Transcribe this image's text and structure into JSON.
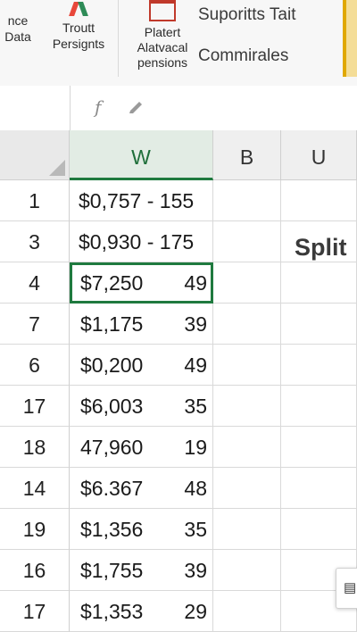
{
  "ribbon": {
    "group1": {
      "line1": "nce",
      "line2": "Data"
    },
    "group2": {
      "line1": "Troutt",
      "line2": "Persignts"
    },
    "group3": {
      "line1": "Platert",
      "line2": "Alatvacal",
      "line3": "pensions"
    },
    "suporitts": "Suporitts Tait",
    "commirales": "Commirales"
  },
  "formula_bar": {
    "fx_icon": "function-icon",
    "pen_icon": "pen-icon"
  },
  "columns": [
    {
      "label": "W",
      "active": true
    },
    {
      "label": "B",
      "active": false
    },
    {
      "label": "U",
      "active": false
    }
  ],
  "rows": [
    {
      "num": "1",
      "text": "$0,757 - 155",
      "amount": "",
      "value": ""
    },
    {
      "num": "3",
      "text": "$0,930 - 175",
      "amount": "",
      "value": ""
    },
    {
      "num": "4",
      "text": "",
      "amount": "$7,250",
      "value": "49",
      "selected": true
    },
    {
      "num": "7",
      "text": "",
      "amount": "$1,175",
      "value": "39"
    },
    {
      "num": "6",
      "text": "",
      "amount": "$0,200",
      "value": "49"
    },
    {
      "num": "17",
      "text": "",
      "amount": "$6,003",
      "value": "35"
    },
    {
      "num": "18",
      "text": "",
      "amount": "47,960",
      "value": "19"
    },
    {
      "num": "14",
      "text": "",
      "amount": "$6.367",
      "value": "48"
    },
    {
      "num": "19",
      "text": "",
      "amount": "$1,356",
      "value": "35"
    },
    {
      "num": "16",
      "text": "",
      "amount": "$1,755",
      "value": "39"
    },
    {
      "num": "17",
      "text": "",
      "amount": "$1,353",
      "value": "29"
    }
  ],
  "split_label": "Split",
  "colors": {
    "accent": "#1f7a3f",
    "header_bg": "#efefef"
  }
}
